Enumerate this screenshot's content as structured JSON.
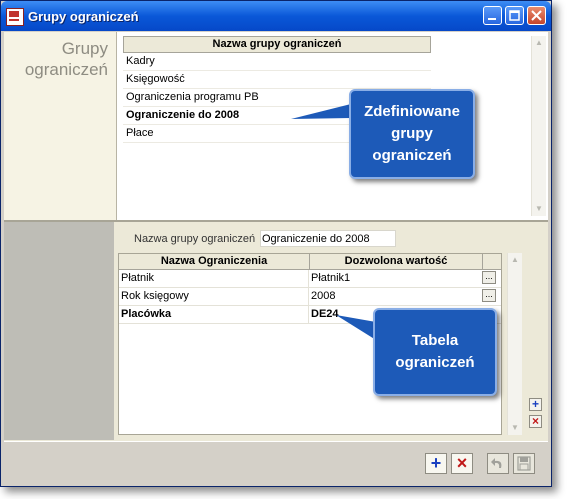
{
  "window": {
    "title": "Grupy ograniczeń"
  },
  "top": {
    "section_title_line1": "Grupy",
    "section_title_line2": "ograniczeń",
    "grid_header": "Nazwa grupy ograniczeń",
    "rows": [
      {
        "label": "Kadry",
        "bold": false
      },
      {
        "label": "Księgowość",
        "bold": false
      },
      {
        "label": "Ograniczenia programu PB",
        "bold": false
      },
      {
        "label": "Ograniczenie do 2008",
        "bold": true
      },
      {
        "label": "Płace",
        "bold": false
      }
    ]
  },
  "bottom": {
    "field_label": "Nazwa grupy ograniczeń",
    "field_value": "Ograniczenie do 2008",
    "col_name": "Nazwa Ograniczenia",
    "col_value": "Dozwolona wartość",
    "rows": [
      {
        "name": "Płatnik",
        "value": "Płatnik1",
        "bold": false
      },
      {
        "name": "Rok księgowy",
        "value": "2008",
        "bold": false
      },
      {
        "name": "Placówka",
        "value": "DE24",
        "bold": true
      }
    ],
    "ellipsis": "...",
    "add_symbol": "+",
    "delete_symbol": "×"
  },
  "footer": {
    "add_symbol": "+",
    "delete_symbol": "×",
    "undo_symbol": "↶",
    "save_symbol": "💾"
  },
  "callouts": {
    "defined_groups": [
      "Zdefiniowane",
      "grupy",
      "ograniczeń"
    ],
    "restrictions_table": [
      "Tabela",
      "ograniczeń"
    ]
  },
  "colors": {
    "titlebar": "#0a58d8",
    "callout": "#1d5ab8",
    "add": "#1a40c0",
    "delete": "#c01818"
  }
}
